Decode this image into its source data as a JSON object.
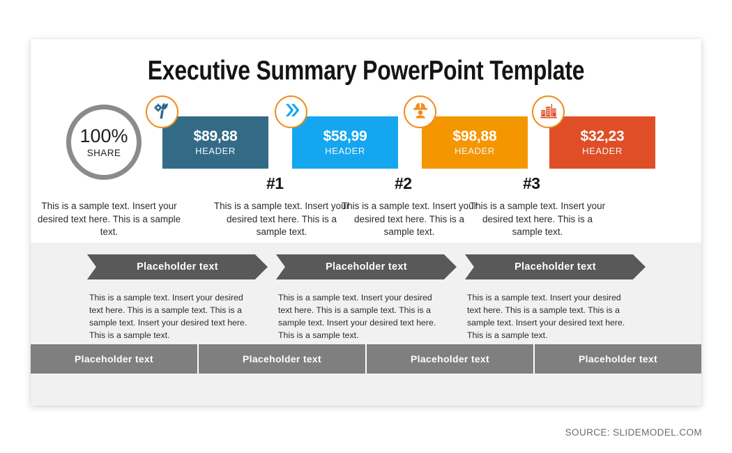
{
  "slide": {
    "title": "Executive Summary PowerPoint Template",
    "share": {
      "percent": "100%",
      "label": "SHARE"
    },
    "kpis": [
      {
        "value": "$89,88",
        "header": "HEADER",
        "color": "#336B87",
        "icon": "plant-gear-icon"
      },
      {
        "value": "$58,99",
        "header": "HEADER",
        "color": "#15A6F0",
        "icon": "double-chevron-icon"
      },
      {
        "value": "$98,88",
        "header": "HEADER",
        "color": "#F49600",
        "icon": "worker-helmet-icon"
      },
      {
        "value": "$32,23",
        "header": "HEADER",
        "color": "#DF4E27",
        "icon": "city-buildings-icon"
      }
    ],
    "badge_border_color": "#F08C1A",
    "step_numbers": [
      "#1",
      "#2",
      "#3"
    ],
    "top_paragraphs": [
      "This is a sample text. Insert your desired text here. This is a sample text.",
      "This is a sample text. Insert your desired text here. This is a sample text.",
      "This is a sample text. Insert your desired text here. This is a sample text.",
      "This is a sample text. Insert your desired text here. This is a sample text."
    ],
    "chevrons": [
      {
        "label": "Placeholder text"
      },
      {
        "label": "Placeholder text"
      },
      {
        "label": "Placeholder text"
      }
    ],
    "band_paragraphs": [
      "This is a sample text. Insert your desired text here. This is a sample text. This is a sample text. Insert your desired text here. This is a sample text.",
      "This is a sample text. Insert your desired text here. This is a sample text. This is a sample text. Insert your desired text here. This is a sample text.",
      "This is a sample text. Insert your desired text here. This is a sample text. This is a sample text. Insert your desired text here. This is a sample text."
    ],
    "strip_cells": [
      "Placeholder text",
      "Placeholder text",
      "Placeholder text",
      "Placeholder text"
    ],
    "band_color": "#F1F1F1",
    "chevron_color": "#595959",
    "strip_color": "#7F7F7F",
    "ring_color": "#8B8B8B"
  },
  "source": "SOURCE: SLIDEMODEL.COM"
}
